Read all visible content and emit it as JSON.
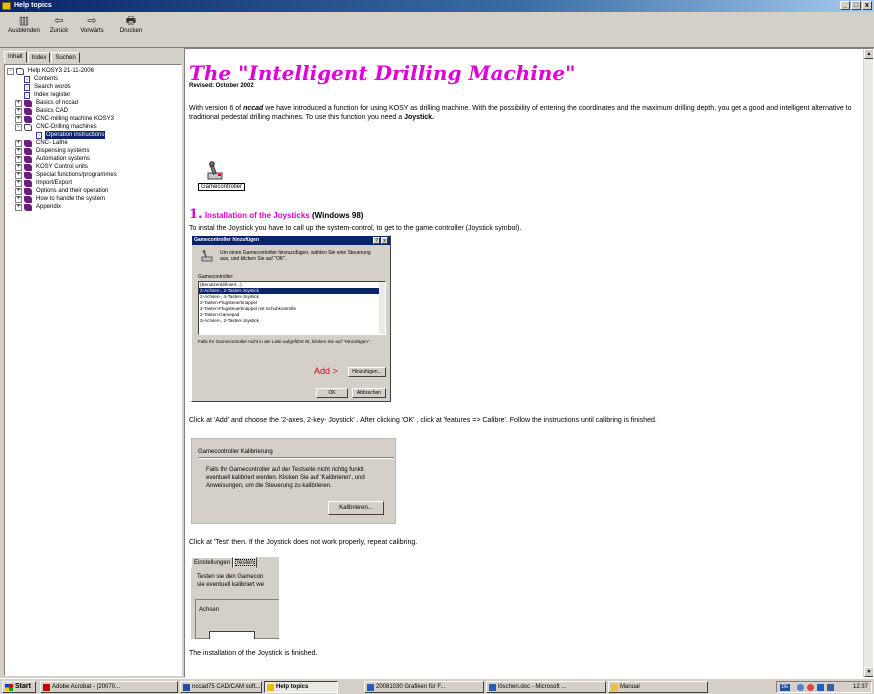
{
  "window": {
    "title": "Help topics",
    "controls": [
      "_",
      "□",
      "x"
    ]
  },
  "toolbar": {
    "buttons": [
      {
        "label": "Ausblenden",
        "icon": "hide-icon"
      },
      {
        "label": "Zurück",
        "icon": "back-arrow-icon"
      },
      {
        "label": "Vorwärts",
        "icon": "forward-arrow-icon"
      },
      {
        "label": "Drucken",
        "icon": "print-icon"
      }
    ]
  },
  "nav": {
    "tabs": [
      "Inhalt",
      "Index",
      "Suchen"
    ],
    "tree": [
      {
        "label": "Help KOSY3 21-11-2006",
        "type": "book-open",
        "level": 0,
        "expander": "-"
      },
      {
        "label": "Contents",
        "type": "page",
        "level": 1
      },
      {
        "label": "Search words",
        "type": "page",
        "level": 1
      },
      {
        "label": "Index register",
        "type": "page",
        "level": 1
      },
      {
        "label": "Basics of nccad",
        "type": "book",
        "level": 1,
        "expander": "+"
      },
      {
        "label": "Basics CAD",
        "type": "book",
        "level": 1,
        "expander": "+"
      },
      {
        "label": "CNC-milling machine KOSY3",
        "type": "book",
        "level": 1,
        "expander": "+"
      },
      {
        "label": "CNC-Drilling machines",
        "type": "book-open",
        "level": 1,
        "expander": "-"
      },
      {
        "label": "Operation instructions",
        "type": "page",
        "level": 2,
        "selected": true
      },
      {
        "label": "CNC- Lathe",
        "type": "book",
        "level": 1,
        "expander": "+"
      },
      {
        "label": "Dispensing systems",
        "type": "book",
        "level": 1,
        "expander": "+"
      },
      {
        "label": "Automation systems",
        "type": "book",
        "level": 1,
        "expander": "+"
      },
      {
        "label": "KOSY Control units",
        "type": "book",
        "level": 1,
        "expander": "+"
      },
      {
        "label": "Special functions/programmes",
        "type": "book",
        "level": 1,
        "expander": "+"
      },
      {
        "label": "Import/Export",
        "type": "book",
        "level": 1,
        "expander": "+"
      },
      {
        "label": "Options and their operation",
        "type": "book",
        "level": 1,
        "expander": "+"
      },
      {
        "label": "How to handle the system",
        "type": "book",
        "level": 1,
        "expander": "+"
      },
      {
        "label": "Appendix",
        "type": "book",
        "level": 1,
        "expander": "+"
      }
    ]
  },
  "content": {
    "title": "The \"Intelligent Drilling Machine\"",
    "revised": "Revised: October 2002",
    "intro_a": "With version 6 of ",
    "intro_b": "nccad",
    "intro_c": " we have introduced a function for using KOSY as drilling machine. With the possibility of entering the coordinates and the maximum drilling depth, you get a good and intelligent alternative to traditional pedestal drilling machines. To use this function you need a ",
    "intro_d": "Joystick.",
    "gc_label": "Gamecontroller",
    "sec1_num": "1.",
    "sec1_title": "Installation of the Joysticks",
    "sec1_suffix": "(Windows 98)",
    "p1": "To instal the Joystick you have to call up the system-control, to get to the game controller (Joystick symbol).",
    "dialog": {
      "title": "Gamecontroller hinzufügen",
      "message": "Um einen Gamecontroller hinzuzufügen, wählen Sie eine Steuerung aus, und klicken Sie auf \"OK\".",
      "group_label": "Gamecontroller:",
      "items": [
        "(Benutzerdefiniert...)",
        "2-Achsen-, 2-Tasten-Joystick",
        "2-Achsen-, 4-Tasten-Joystick",
        "2-Tasten-Flugsteuerknüppel",
        "2-Tasten-Flugsteuerknüppel mit Schubkontrolle",
        "2-Tasten-Gamepad",
        "3-Achsen-, 2-Tasten-Joystick"
      ],
      "selected_index": 1,
      "hint": "Falls Ihr Gamecontroller nicht in der Liste aufgeführt ist, klicken Sie auf \"Hinzufügen\".",
      "add_annotation": "Add >",
      "add_button": "Hinzufügen...",
      "ok_button": "OK",
      "cancel_button": "Abbrechen"
    },
    "p2": "Click at 'Add' and choose the '2-axes, 2-key- Joystick' . After clicking 'OK' , click at 'features => Calibre'. Follow the instructions until calibring is finished.",
    "kal": {
      "group_label": "Gamecontroller Kalibrierung",
      "text_1": "Falls Ihr Gamecontroller auf der Testseite nicht richtig funkti",
      "text_2": "eventuell kalibriert werden. Klicken Sie auf 'Kalibrieren', und",
      "text_3": "Anweisungen, um die Steuerung zu kalibrieren.",
      "button": "Kalibrieren..."
    },
    "p3": "Click at 'Test' then. If the Joystick does not work properly, repeat calibring.",
    "test": {
      "tab_1": "Einstellungen",
      "tab_2": "Testen",
      "text_1": "Testen sie den Gamecon",
      "text_2": "sie eventuell kalibriert we",
      "group": "Achsen"
    },
    "p4": "The installation of the Joystick is finished."
  },
  "taskbar": {
    "start": "Start",
    "tasks": [
      {
        "label": "Adobe Acrobat - [20070...",
        "active": false
      },
      {
        "label": "nccad75  CAD/CAM soft...",
        "active": false
      },
      {
        "label": "Help topics",
        "active": true
      },
      {
        "label": "20081030 Grafiken für F...",
        "active": false
      },
      {
        "label": "löschen.doc - Microsoft ...",
        "active": false
      },
      {
        "label": "Manual",
        "active": false
      }
    ],
    "tray_lang": "DE",
    "clock": "12:37"
  },
  "colors": {
    "heading": "#e000d8",
    "titlebar": "#0a246a",
    "annotation": "#e00020"
  }
}
